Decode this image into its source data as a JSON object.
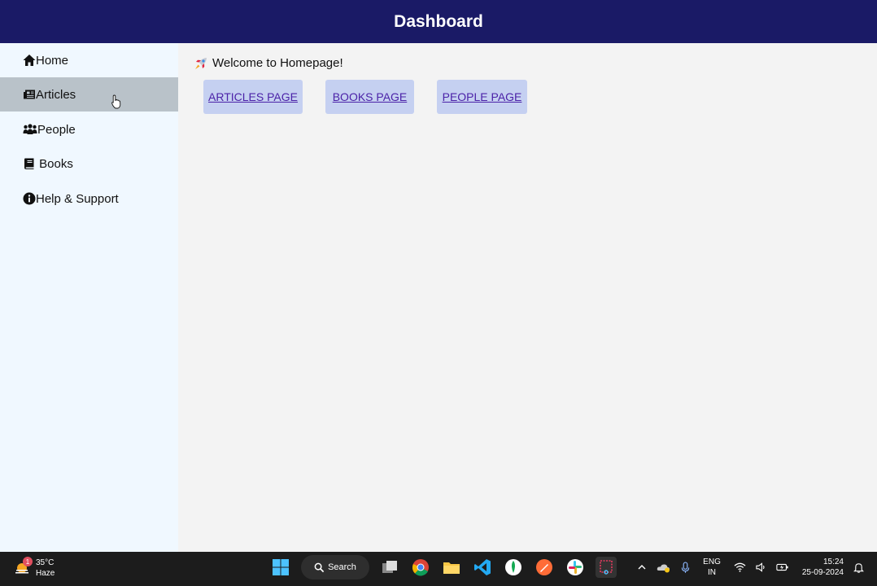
{
  "header": {
    "title": "Dashboard"
  },
  "sidebar": {
    "items": [
      {
        "label": "Home",
        "icon": "home-icon"
      },
      {
        "label": "Articles",
        "icon": "newspaper-icon",
        "active": true
      },
      {
        "label": "People",
        "icon": "people-icon"
      },
      {
        "label": " Books",
        "icon": "book-icon"
      },
      {
        "label": "Help & Support",
        "icon": "info-icon"
      }
    ]
  },
  "main": {
    "welcome": "Welcome to Homepage!",
    "buttons": [
      {
        "label": "ARTICLES PAGE"
      },
      {
        "label": "BOOKS PAGE"
      },
      {
        "label": "PEOPLE PAGE"
      }
    ]
  },
  "taskbar": {
    "weather": {
      "temp": "35°C",
      "condition": "Haze",
      "badge": "1"
    },
    "search_label": "Search",
    "lang": {
      "top": "ENG",
      "bottom": "IN"
    },
    "clock": {
      "time": "15:24",
      "date": "25-09-2024"
    }
  },
  "colors": {
    "header": "#1a1a66",
    "sidebar": "#f0f8ff",
    "active": "#b9c2c9",
    "button": "#c5d0f1",
    "link": "#4b22a8"
  }
}
